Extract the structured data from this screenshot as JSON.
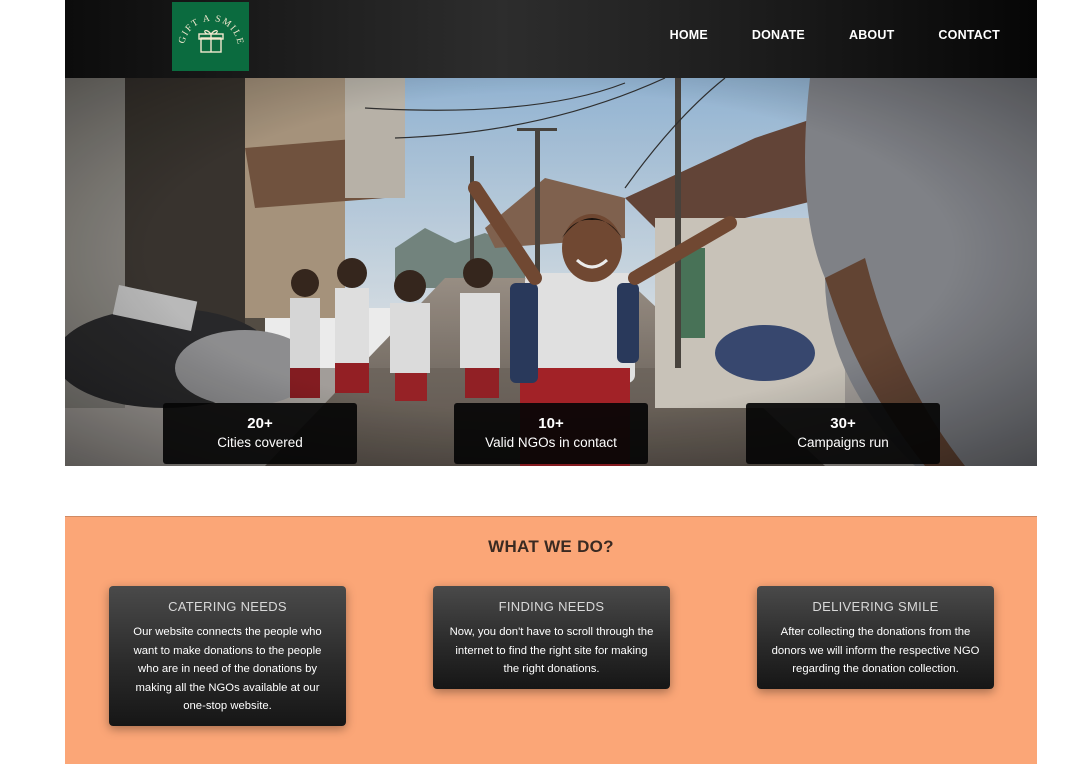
{
  "logo": {
    "text": "GIFT A SMILE",
    "icon": "gift-box-icon"
  },
  "nav": {
    "items": [
      {
        "label": "HOME"
      },
      {
        "label": "DONATE"
      },
      {
        "label": "ABOUT"
      },
      {
        "label": "CONTACT"
      }
    ]
  },
  "hero": {
    "image": "children-in-school-uniforms-street-photo",
    "stats": [
      {
        "value": "20+",
        "label": "Cities covered"
      },
      {
        "value": "10+",
        "label": "Valid NGOs in contact"
      },
      {
        "value": "30+",
        "label": "Campaigns run"
      }
    ]
  },
  "what_we_do": {
    "title": "WHAT WE DO?",
    "cards": [
      {
        "title": "CATERING NEEDS",
        "text": "Our website connects the people who want to make donations to the people who are in need of the donations by making all the NGOs available at our one-stop website."
      },
      {
        "title": "FINDING NEEDS",
        "text": "Now, you don't have to scroll through the internet to find the right site for making the right donations."
      },
      {
        "title": "DELIVERING SMILE",
        "text": "After collecting the donations from the donors we will inform the respective NGO regarding the donation collection."
      }
    ]
  },
  "colors": {
    "header": "#1a1a1a",
    "logo_bg": "#0b6b3f",
    "section_bg": "#fba677",
    "card_bg": "#2b2b2b"
  }
}
